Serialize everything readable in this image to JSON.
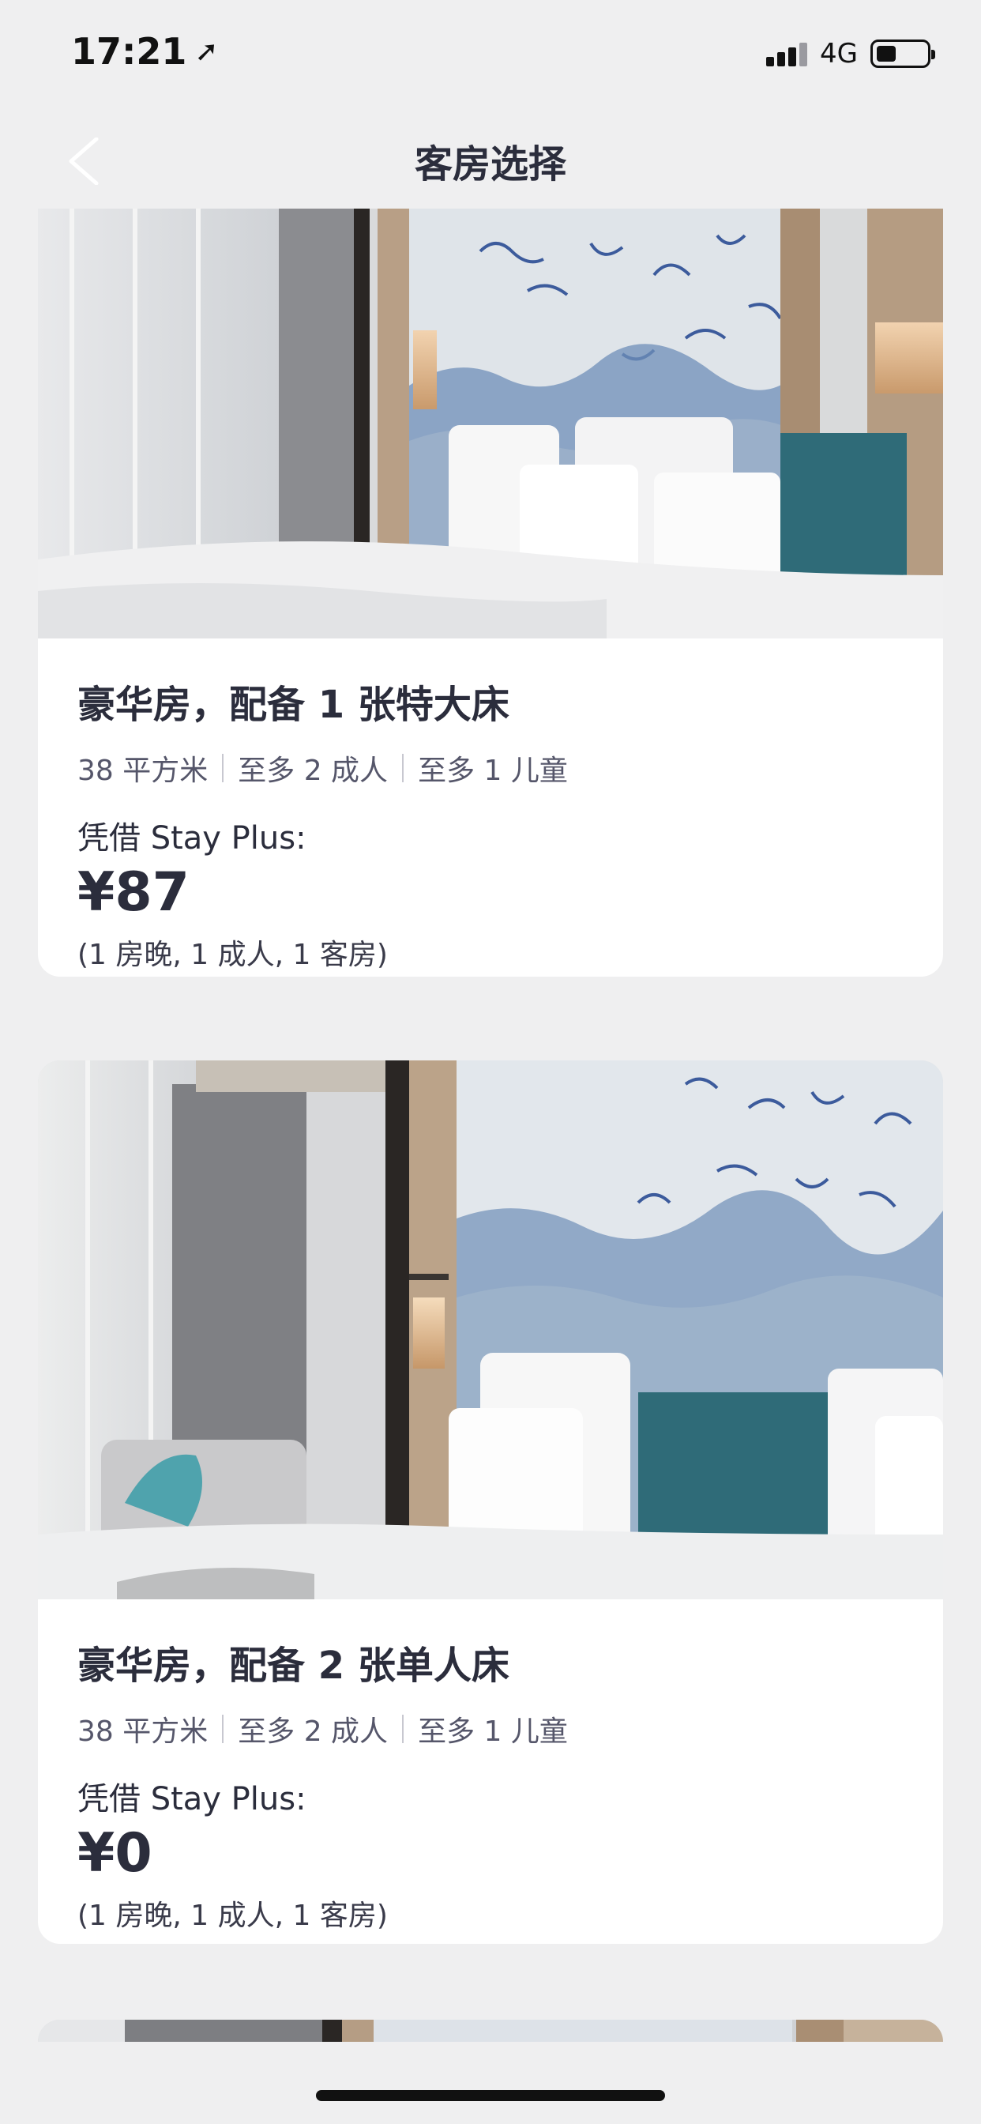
{
  "status_bar": {
    "time": "17:21",
    "network": "4G",
    "battery_level": 0.4
  },
  "nav": {
    "title": "客房选择"
  },
  "rooms": [
    {
      "name": "豪华房，配备 1 张特大床",
      "area": "38 平方米",
      "adults": "至多 2 成人",
      "children": "至多 1 儿童",
      "price_label": "凭借 Stay Plus:",
      "price": "¥87",
      "price_note": "(1 房晚, 1 成人, 1 客房)"
    },
    {
      "name": "豪华房，配备 2 张单人床",
      "area": "38 平方米",
      "adults": "至多 2 成人",
      "children": "至多 1 儿童",
      "price_label": "凭借 Stay Plus:",
      "price": "¥0",
      "price_note": "(1 房晚, 1 成人, 1 客房)"
    }
  ],
  "colors": {
    "background": "#efeff0",
    "card": "#ffffff",
    "text_primary": "#2b2d3c",
    "headboard_teal": "#2f6b78"
  }
}
